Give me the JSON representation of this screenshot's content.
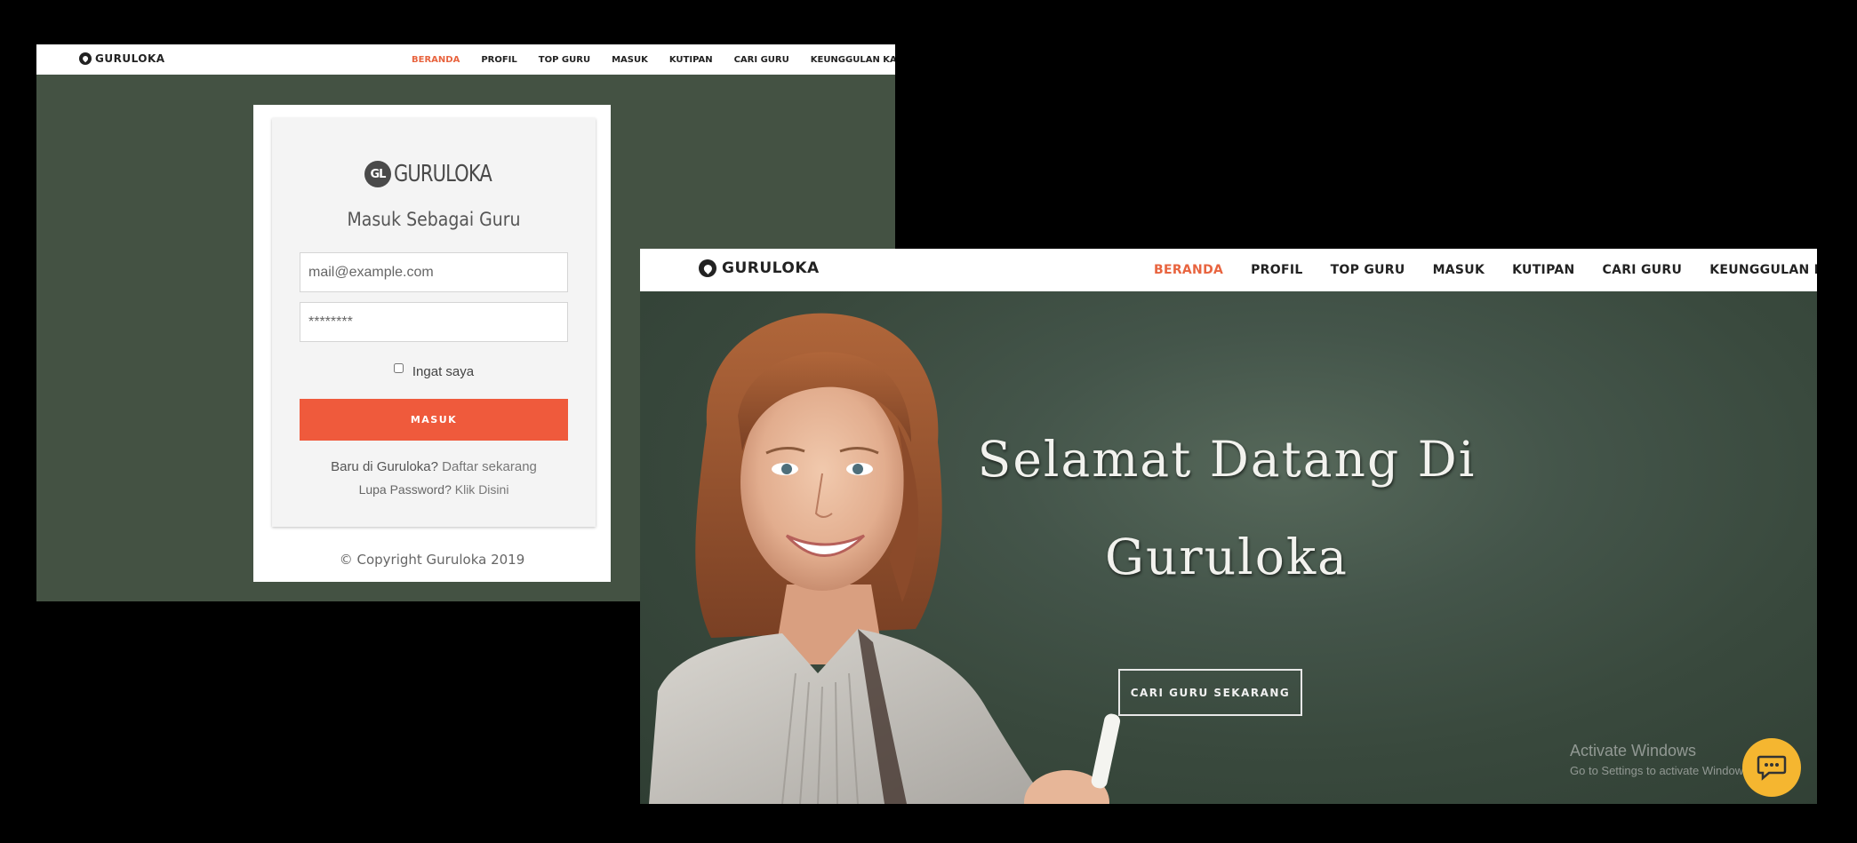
{
  "brand": {
    "name": "GURULOKA"
  },
  "nav": {
    "items": [
      {
        "label": "BERANDA",
        "active": true
      },
      {
        "label": "PROFIL",
        "active": false
      },
      {
        "label": "TOP GURU",
        "active": false
      },
      {
        "label": "MASUK",
        "active": false
      },
      {
        "label": "KUTIPAN",
        "active": false
      },
      {
        "label": "CARI GURU",
        "active": false
      },
      {
        "label": "KEUNGGULAN KAMI",
        "active": false
      }
    ]
  },
  "login": {
    "logo_badge": "GL",
    "logo_text": "GURULOKA",
    "title": "Masuk Sebagai Guru",
    "email_placeholder": "mail@example.com",
    "password_placeholder": "********",
    "remember_label": "Ingat saya",
    "submit_label": "MASUK",
    "register_prefix": "Baru di Guruloka?",
    "register_link": "Daftar sekarang",
    "forgot_prefix": "Lupa Password?",
    "forgot_link": "Klik Disini",
    "copyright": "© Copyright Guruloka 2019"
  },
  "hero": {
    "line1": "Selamat Datang Di",
    "line2": "Guruloka",
    "cta_label": "CARI GURU SEKARANG"
  },
  "watermark": {
    "title": "Activate Windows",
    "subtitle": "Go to Settings to activate Windows."
  },
  "colors": {
    "accent": "#ef5a3c",
    "login_background": "#445243",
    "hero_background": "#39493b",
    "chat_button": "#f5b630"
  },
  "icons": {
    "brand": "guruloka-logo-icon",
    "chat": "chat-bubble-icon"
  }
}
